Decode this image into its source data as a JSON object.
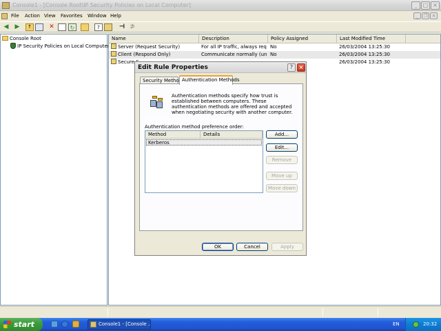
{
  "window": {
    "title": "Console1 - [Console Root\\IP Security Policies on Local Computer]",
    "controls": {
      "minimize": "_",
      "maximize": "□",
      "close": "×"
    }
  },
  "menubar": {
    "items": [
      "File",
      "Action",
      "View",
      "Favorites",
      "Window",
      "Help"
    ]
  },
  "toolbar": {
    "icons": [
      "back-icon",
      "forward-icon",
      "up-folder-icon",
      "show-tree-icon",
      "delete-icon",
      "properties-icon",
      "refresh-icon",
      "export-icon",
      "help-icon",
      "manage-filters-icon",
      "add-policy-icon",
      "assign-icon",
      "unassign-icon"
    ]
  },
  "tree": {
    "root": "Console Root",
    "child": "IP Security Policies on Local Computer"
  },
  "list": {
    "columns": [
      "Name",
      "Description",
      "Policy Assigned",
      "Last Modified Time"
    ],
    "rows": [
      {
        "name": "Server (Request Security)",
        "description": "For all IP traffic, always req...",
        "assigned": "No",
        "modified": "26/03/2004 13:25:30"
      },
      {
        "name": "Client (Respond Only)",
        "description": "Communicate normally (uns...",
        "assigned": "No",
        "modified": "26/03/2004 13:25:30"
      },
      {
        "name": "Secure S",
        "description": "",
        "assigned": "",
        "modified": "26/03/2004 13:25:30"
      }
    ]
  },
  "dialog": {
    "title": "Edit Rule Properties",
    "help_glyph": "?",
    "close_glyph": "×",
    "tabs": [
      "Security Methods",
      "Authentication Methods"
    ],
    "active_tab": "Authentication Methods",
    "description": "Authentication methods specify how trust is established between computers. These authentication methods are offered and accepted when negotiating security with another computer.",
    "pref_label": "Authentication method preference order:",
    "methods_columns": [
      "Method",
      "Details"
    ],
    "methods_rows": [
      {
        "method": "Kerberos",
        "details": ""
      }
    ],
    "side_buttons": {
      "add": "Add...",
      "edit": "Edit...",
      "remove": "Remove",
      "move_up": "Move up",
      "move_down": "Move down"
    },
    "footer_buttons": {
      "ok": "OK",
      "cancel": "Cancel",
      "apply": "Apply"
    }
  },
  "taskbar": {
    "start": "start",
    "task_item": "Console1 - [Console ...",
    "language": "EN",
    "clock": "20:32"
  },
  "colors": {
    "taskbar": "#245edb",
    "start": "#3c9c3c",
    "tab_highlight": "#e6a532"
  }
}
